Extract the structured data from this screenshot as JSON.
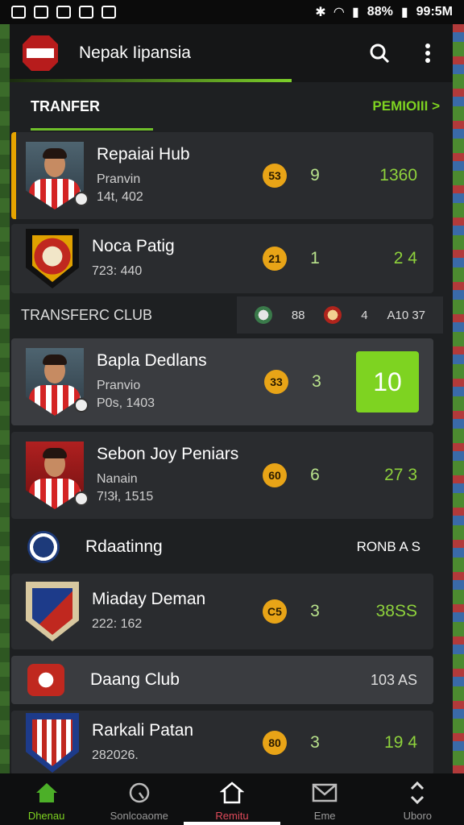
{
  "status_bar": {
    "battery": "88%",
    "time": "99:5M"
  },
  "app_bar": {
    "title": "Nepak Iipansia"
  },
  "transfer_section": {
    "heading": "TRANFER",
    "more_label": "PEMIOIII >"
  },
  "players": [
    {
      "name": "Repaiai Hub",
      "position": "Pranvin",
      "stats": "14t, 402",
      "coin": "53",
      "count": "9",
      "value": "1360"
    },
    {
      "name": "Noca Patig",
      "position": "",
      "stats": "723: 440",
      "coin": "21",
      "count": "1",
      "value": "2 4"
    },
    {
      "name": "Bapla Dedlans",
      "position": "Pranvio",
      "stats": "P0s, 1403",
      "coin": "33",
      "count": "3",
      "value": "10"
    },
    {
      "name": "Sebon Joy Peniars",
      "position": "Nanain",
      "stats": "7!3ł, 1515",
      "coin": "60",
      "count": "6",
      "value": "27 3"
    }
  ],
  "transfer_club": {
    "heading": "TRANSFERC CLUB",
    "filter_value1": "88",
    "filter_value2": "4",
    "filter_value3": "A10 37"
  },
  "club_rating": {
    "title": "Rdaatinng",
    "right_label": "RONB A S"
  },
  "clubs": [
    {
      "name": "Miaday Deman",
      "stats": "222: 162",
      "coin": "C5",
      "count": "3",
      "value": "38SS"
    },
    {
      "name": "Daang Club",
      "value": "103 AS"
    },
    {
      "name": "Rarkali Patan",
      "stats": "282026.",
      "coin": "80",
      "count": "3",
      "value": "19 4"
    }
  ],
  "bottom_nav": [
    {
      "label": "Dhenau",
      "icon": "home-icon"
    },
    {
      "label": "Sonlcoaome",
      "icon": "scout-icon"
    },
    {
      "label": "Remitu",
      "icon": "transfer-icon"
    },
    {
      "label": "Eme",
      "icon": "mail-icon"
    },
    {
      "label": "Uboro",
      "icon": "swap-icon"
    }
  ],
  "colors": {
    "accent_green": "#7ed321",
    "coin_gold": "#e8a417",
    "highlight_orange": "#e6a400",
    "panel_dark": "#1e2022"
  }
}
